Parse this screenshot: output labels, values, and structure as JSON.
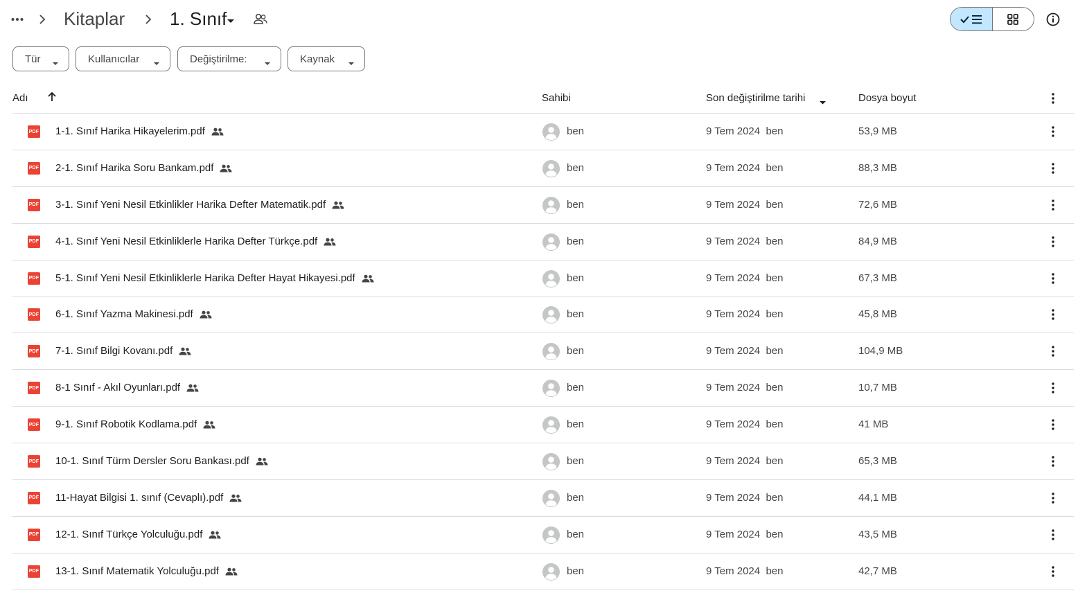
{
  "breadcrumb": {
    "parent": "Kitaplar",
    "current": "1. Sınıf"
  },
  "filters": [
    {
      "label": "Tür"
    },
    {
      "label": "Kullanıcılar"
    },
    {
      "label": "Değiştirilme:"
    },
    {
      "label": "Kaynak"
    }
  ],
  "columns": {
    "name": "Adı",
    "owner": "Sahibi",
    "modified": "Son değiştirilme tarihi",
    "size": "Dosya boyut"
  },
  "files": [
    {
      "name": "1-1. Sınıf Harika Hikayelerim.pdf",
      "owner": "ben",
      "modified": "9 Tem 2024  ben",
      "size": "53,9 MB"
    },
    {
      "name": "2-1. Sınıf Harika Soru Bankam.pdf",
      "owner": "ben",
      "modified": "9 Tem 2024  ben",
      "size": "88,3 MB"
    },
    {
      "name": "3-1. Sınıf Yeni Nesil Etkinlikler Harika Defter Matematik.pdf",
      "owner": "ben",
      "modified": "9 Tem 2024  ben",
      "size": "72,6 MB"
    },
    {
      "name": "4-1. Sınıf Yeni Nesil Etkinliklerle Harika Defter Türkçe.pdf",
      "owner": "ben",
      "modified": "9 Tem 2024  ben",
      "size": "84,9 MB"
    },
    {
      "name": "5-1. Sınıf Yeni Nesil Etkinliklerle Harika Defter Hayat Hikayesi.pdf",
      "owner": "ben",
      "modified": "9 Tem 2024  ben",
      "size": "67,3 MB"
    },
    {
      "name": "6-1. Sınıf Yazma Makinesi.pdf",
      "owner": "ben",
      "modified": "9 Tem 2024  ben",
      "size": "45,8 MB"
    },
    {
      "name": "7-1. Sınıf Bilgi Kovanı.pdf",
      "owner": "ben",
      "modified": "9 Tem 2024  ben",
      "size": "104,9 MB"
    },
    {
      "name": "8-1  Sınıf - Akıl Oyunları.pdf",
      "owner": "ben",
      "modified": "9 Tem 2024  ben",
      "size": "10,7 MB"
    },
    {
      "name": "9-1. Sınıf Robotik Kodlama.pdf",
      "owner": "ben",
      "modified": "9 Tem 2024  ben",
      "size": "41 MB"
    },
    {
      "name": "10-1. Sınıf Türm Dersler Soru Bankası.pdf",
      "owner": "ben",
      "modified": "9 Tem 2024  ben",
      "size": "65,3 MB"
    },
    {
      "name": "11-Hayat Bilgisi 1. sınıf (Cevaplı).pdf",
      "owner": "ben",
      "modified": "9 Tem 2024  ben",
      "size": "44,1 MB"
    },
    {
      "name": "12-1. Sınıf Türkçe Yolculuğu.pdf",
      "owner": "ben",
      "modified": "9 Tem 2024  ben",
      "size": "43,5 MB"
    },
    {
      "name": "13-1. Sınıf Matematik Yolculuğu.pdf",
      "owner": "ben",
      "modified": "9 Tem 2024  ben",
      "size": "42,7 MB"
    }
  ],
  "icons": {
    "file_type": "pdf-icon",
    "file_type_label": "PDF",
    "shared": "shared-people-icon",
    "row_menu": "more-vert-icon"
  },
  "colors": {
    "pdf": "#ea4335",
    "active_view": "#c2e7ff",
    "divider": "#dadce0"
  }
}
